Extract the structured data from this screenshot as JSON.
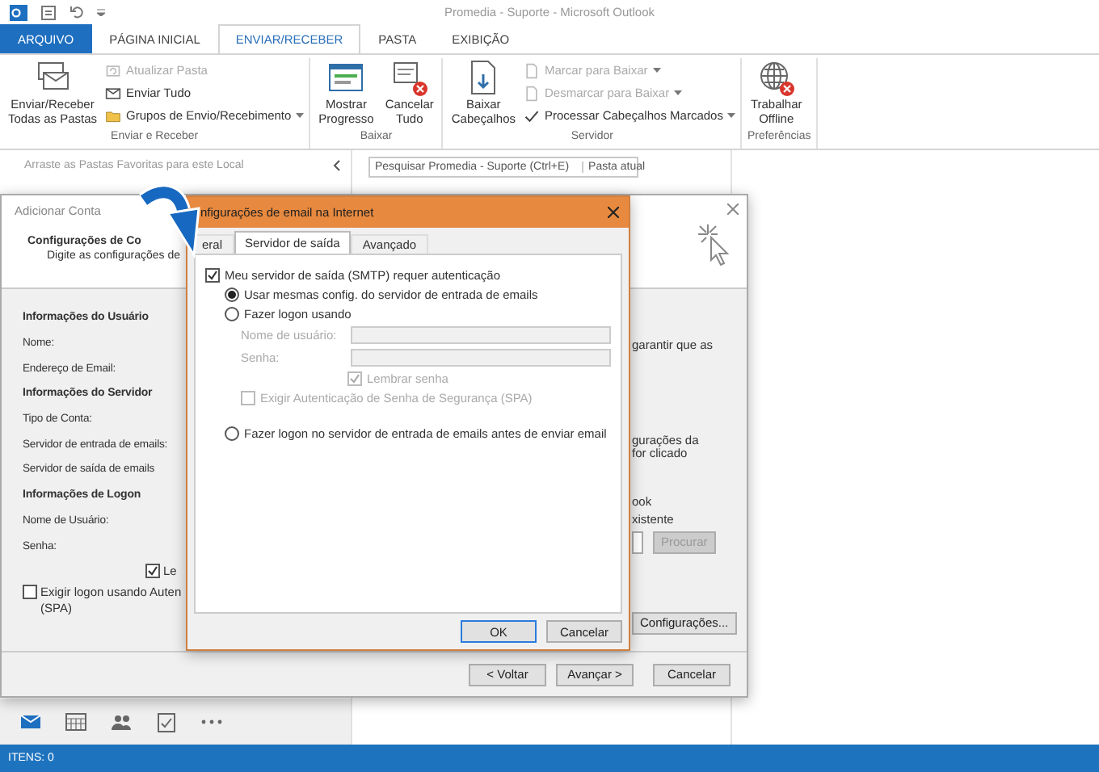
{
  "window": {
    "title": "Promedia - Suporte - Microsoft Outlook"
  },
  "ribbon_tabs": [
    {
      "label": "ARQUIVO",
      "kind": "file",
      "selected": false
    },
    {
      "label": "PÁGINA INICIAL",
      "kind": "tab",
      "selected": false
    },
    {
      "label": "ENVIAR/RECEBER",
      "kind": "tab",
      "selected": true
    },
    {
      "label": "PASTA",
      "kind": "tab",
      "selected": false
    },
    {
      "label": "EXIBIÇÃO",
      "kind": "tab",
      "selected": false
    }
  ],
  "ribbon_groups": [
    {
      "label": "Enviar e Receber",
      "buttons": [
        {
          "label": "Enviar/Receber\nTodas as Pastas",
          "kind": "large",
          "disabled": false,
          "dropdown": false
        },
        {
          "label": "Atualizar Pasta",
          "kind": "small",
          "disabled": true,
          "dropdown": false
        },
        {
          "label": "Enviar Tudo",
          "kind": "small",
          "disabled": false,
          "dropdown": false
        },
        {
          "label": "Grupos de Envio/Recebimento",
          "kind": "small",
          "disabled": false,
          "dropdown": true
        }
      ]
    },
    {
      "label": "Baixar",
      "buttons": [
        {
          "label": "Mostrar\nProgresso",
          "kind": "large",
          "disabled": false,
          "dropdown": false
        },
        {
          "label": "Cancelar\nTudo",
          "kind": "large",
          "disabled": false,
          "dropdown": false
        }
      ]
    },
    {
      "label": "Servidor",
      "buttons": [
        {
          "label": "Baixar\nCabeçalhos",
          "kind": "large",
          "disabled": false,
          "dropdown": false
        },
        {
          "label": "Marcar para Baixar",
          "kind": "small",
          "disabled": true,
          "dropdown": true
        },
        {
          "label": "Desmarcar para Baixar",
          "kind": "small",
          "disabled": true,
          "dropdown": true
        },
        {
          "label": "Processar Cabeçalhos Marcados",
          "kind": "small",
          "disabled": false,
          "dropdown": true
        }
      ]
    },
    {
      "label": "Preferências",
      "buttons": [
        {
          "label": "Trabalhar\nOffline",
          "kind": "large",
          "disabled": false,
          "dropdown": false
        }
      ]
    }
  ],
  "nav_pane": {
    "favorites_hint": "Arraste as Pastas Favoritas para este Local"
  },
  "search": {
    "placeholder": "Pesquisar Promedia - Suporte (Ctrl+E)",
    "scope": "Pasta atual"
  },
  "nav_bar": [
    {
      "selected": true
    },
    {
      "selected": false
    },
    {
      "selected": false
    },
    {
      "selected": false
    },
    {
      "selected": false
    }
  ],
  "status_bar": {
    "text": "ITENS: 0"
  },
  "add_account_dialog": {
    "title": "Adicionar Conta",
    "heading": "Configurações de Co",
    "subtitle": "Digite as configurações de",
    "rows": [
      {
        "kind": "heading",
        "text": "Informações do Usuário"
      },
      {
        "kind": "label",
        "text": "Nome:"
      },
      {
        "kind": "label",
        "text": "Endereço de Email:"
      },
      {
        "kind": "heading",
        "text": "Informações do Servidor"
      },
      {
        "kind": "label",
        "text": "Tipo de Conta:"
      },
      {
        "kind": "label",
        "text": "Servidor de entrada de emails:"
      },
      {
        "kind": "label",
        "text": "Servidor de saída de emails"
      },
      {
        "kind": "heading",
        "text": "Informações de Logon"
      },
      {
        "kind": "label",
        "text": "Nome de Usuário:"
      },
      {
        "kind": "label",
        "text": "Senha:"
      }
    ],
    "remember": {
      "label": "Le",
      "checked": true
    },
    "spa": {
      "label": "Exigir logon usando Auten\n(SPA)",
      "checked": false
    },
    "right_texts": [
      "garantir que as",
      "gurações da\nfor clicado",
      "ook",
      "xistente"
    ],
    "browse_button": {
      "label": "Procurar",
      "disabled": true
    },
    "settings_button": {
      "label": "Configurações..."
    },
    "footer_buttons": [
      "< Voltar",
      "Avançar >",
      "Cancelar"
    ]
  },
  "internet_dialog": {
    "title": "nfigurações de email na Internet",
    "tabs": [
      {
        "label": "eral",
        "selected": false
      },
      {
        "label": "Servidor de saída",
        "selected": true
      },
      {
        "label": "Avançado",
        "selected": false
      }
    ],
    "requires_auth": {
      "label": "Meu servidor de saída (SMTP) requer autenticação",
      "checked": true
    },
    "radios": [
      {
        "label": "Usar mesmas config. do servidor de entrada de emails",
        "selected": true
      },
      {
        "label": "Fazer logon usando",
        "selected": false
      },
      {
        "label": "Fazer logon no servidor de entrada de emails antes de enviar email",
        "selected": false
      }
    ],
    "fields": [
      {
        "label": "Nome de usuário:",
        "disabled": true
      },
      {
        "label": "Senha:",
        "disabled": true
      }
    ],
    "remember": {
      "label": "Lembrar senha",
      "checked": true,
      "disabled": true
    },
    "spa": {
      "label": "Exigir Autenticação de Senha de Segurança (SPA)",
      "checked": false,
      "disabled": true
    },
    "buttons": [
      {
        "label": "OK",
        "default": true
      },
      {
        "label": "Cancelar",
        "default": false
      }
    ]
  }
}
